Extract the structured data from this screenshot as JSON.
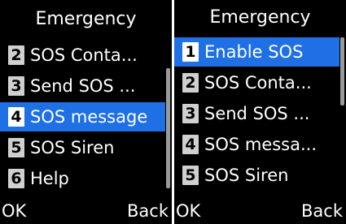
{
  "screens": [
    {
      "title": "Emergency",
      "items": [
        {
          "num": "2",
          "label": "SOS Conta...",
          "selected": false
        },
        {
          "num": "3",
          "label": "Send SOS ...",
          "selected": false
        },
        {
          "num": "4",
          "label": "SOS message",
          "selected": true
        },
        {
          "num": "5",
          "label": "SOS Siren",
          "selected": false
        },
        {
          "num": "6",
          "label": "Help",
          "selected": false
        }
      ],
      "softkeys": {
        "left": "OK",
        "right": "Back"
      }
    },
    {
      "title": "Emergency",
      "items": [
        {
          "num": "1",
          "label": "Enable SOS",
          "selected": true
        },
        {
          "num": "2",
          "label": "SOS Conta...",
          "selected": false
        },
        {
          "num": "3",
          "label": "Send SOS ...",
          "selected": false
        },
        {
          "num": "4",
          "label": "SOS messa...",
          "selected": false
        },
        {
          "num": "5",
          "label": "SOS Siren",
          "selected": false
        }
      ],
      "softkeys": {
        "left": "OK",
        "right": "Back"
      }
    }
  ],
  "colors": {
    "background": "#000000",
    "selection": "#1f6fe5",
    "text": "#ffffff"
  }
}
